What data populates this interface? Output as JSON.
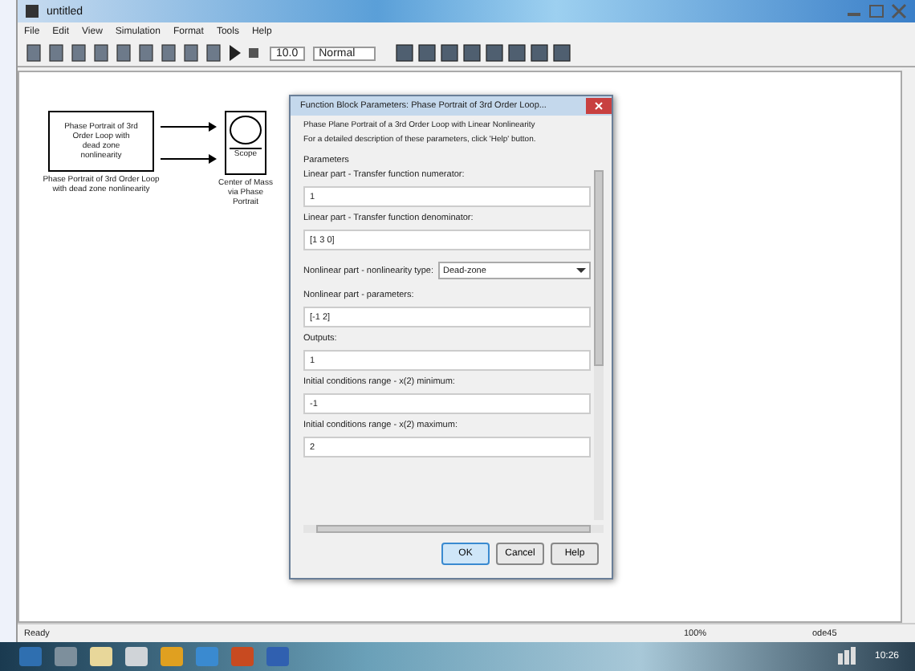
{
  "window": {
    "title": "untitled"
  },
  "menu": [
    "File",
    "Edit",
    "View",
    "Simulation",
    "Format",
    "Tools",
    "Help"
  ],
  "toolbar": {
    "stop_time": "10.0",
    "mode": "Normal"
  },
  "diagram": {
    "blocks": [
      {
        "kind": "subsystem",
        "text": "Phase Portrait of 3rd Order Loop with dead zone nonlinearity",
        "caption": "Phase Portrait of 3rd Order Loop with dead zone nonlinearity"
      },
      {
        "kind": "scope",
        "text": "Scope",
        "caption": "Center of Mass via Phase Portrait"
      }
    ]
  },
  "dialog": {
    "title": "Function Block Parameters: Phase Portrait of 3rd Order Loop...",
    "description": [
      "Phase Plane Portrait of a 3rd Order Loop with Linear Nonlinearity",
      "For a detailed description of these parameters, click 'Help' button."
    ],
    "section": "Parameters",
    "params": [
      {
        "kind": "text",
        "label": "Linear part - Transfer function numerator:",
        "value": "1"
      },
      {
        "kind": "text",
        "label": "Linear part - Transfer function denominator:",
        "value": "[1 3 0]"
      },
      {
        "kind": "select",
        "label": "Nonlinear part - nonlinearity type:",
        "value": "Dead-zone"
      },
      {
        "kind": "text",
        "label": "Nonlinear part - parameters:",
        "value": "[-1 2]"
      },
      {
        "kind": "text",
        "label": "Outputs:",
        "value": "1"
      },
      {
        "kind": "text",
        "label": "Initial conditions range - x(2) minimum:",
        "value": "-1"
      },
      {
        "kind": "text",
        "label": "Initial conditions range - x(2) maximum:",
        "value": "2"
      }
    ],
    "buttons": [
      {
        "label": "OK",
        "selected": true
      },
      {
        "label": "Cancel",
        "selected": false
      },
      {
        "label": "Help",
        "selected": false
      }
    ]
  },
  "status_bar": {
    "left": "Ready",
    "zoom": "100%",
    "solver": "ode45"
  },
  "taskbar": {
    "time": "10:26"
  }
}
